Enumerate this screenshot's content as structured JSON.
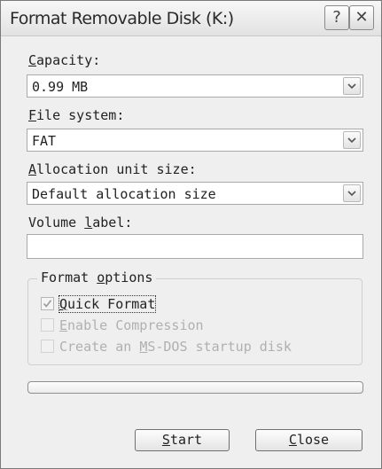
{
  "window": {
    "title": "Format  Removable Disk (K:)",
    "help_glyph": "?",
    "close_glyph": "✕"
  },
  "capacity": {
    "label_access": "C",
    "label_rest": "apacity:",
    "value": "0.99 MB"
  },
  "file_system": {
    "label_access": "F",
    "label_rest": "ile system:",
    "value": "FAT"
  },
  "allocation": {
    "label_access": "A",
    "label_rest": "llocation unit size:",
    "value": "Default allocation size"
  },
  "volume": {
    "label_pre": "Volume ",
    "label_access": "l",
    "label_rest": "abel:",
    "value": ""
  },
  "format_options": {
    "legend_pre": "Format ",
    "legend_access": "o",
    "legend_rest": "ptions",
    "quick_format": {
      "label_access": "Q",
      "label_rest": "uick Format",
      "checked": true,
      "enabled": true
    },
    "compression": {
      "label_access": "E",
      "label_rest": "nable Compression",
      "checked": false,
      "enabled": false
    },
    "msdos": {
      "label_pre": "Create an ",
      "label_access": "M",
      "label_rest": "S-DOS startup disk",
      "checked": false,
      "enabled": false
    }
  },
  "progress": {
    "fraction": 0
  },
  "buttons": {
    "start_access": "S",
    "start_rest": "tart",
    "close_access": "C",
    "close_rest": "lose"
  },
  "icons": {
    "dropdown": "chevron-down-icon",
    "check": "checkmark-icon"
  }
}
